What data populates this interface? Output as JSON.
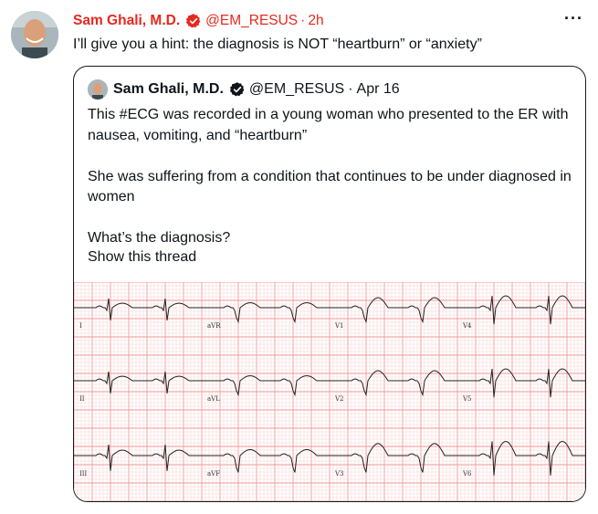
{
  "tweet": {
    "author_name": "Sam Ghali, M.D.",
    "handle": "@EM_RESUS",
    "separator": "·",
    "time": "2h",
    "more": "···",
    "text": "I’ll give you a hint: the diagnosis is NOT “heartburn” or “anxiety”"
  },
  "quoted": {
    "author_name": "Sam Ghali, M.D.",
    "handle": "@EM_RESUS",
    "separator": "·",
    "date": "Apr 16",
    "lines": [
      "This #ECG was recorded in a young woman who presented to the ER with nausea, vomiting, and “heartburn”",
      "She was suffering from a condition that continues to be under diagnosed in women",
      "What’s the diagnosis?"
    ],
    "show_thread": "Show this thread"
  },
  "ecg": {
    "lead_labels": [
      "I",
      "aVR",
      "V1",
      "V4",
      "II",
      "aVL",
      "V2",
      "V5",
      "III",
      "aVF",
      "V3",
      "V6"
    ]
  },
  "colors": {
    "accent": "#e8281d",
    "verified": "#e8281d",
    "grid_minor": "#f7c6c6",
    "grid_major": "#ef9a9a"
  }
}
